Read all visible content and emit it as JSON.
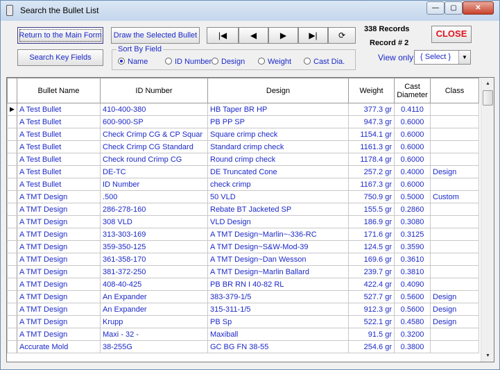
{
  "window": {
    "title": "Search the Bullet List",
    "min": "—",
    "max": "▢",
    "close": "✕"
  },
  "toolbar": {
    "return_label": "Return to the Main Form",
    "draw_label": "Draw the Selected Bullet",
    "search_label": "Search Key Fields",
    "first": "|◀",
    "prev": "◀",
    "next": "▶",
    "last": "▶|",
    "refresh": "⟳",
    "close_label": "CLOSE"
  },
  "status": {
    "records": "338  Records",
    "record": "Record #  2"
  },
  "sortby": {
    "legend": "Sort By Field",
    "options": [
      "Name",
      "ID Number",
      "Design",
      "Weight",
      "Cast Dia."
    ],
    "selected": "Name"
  },
  "view": {
    "label": "View only",
    "value": "{ Select }"
  },
  "grid": {
    "headers": [
      "Bullet Name",
      "ID Number",
      "Design",
      "Weight",
      "Cast\nDiameter",
      "Class"
    ],
    "rows": [
      [
        "A Test Bullet",
        "410-400-380",
        "HB Taper BR HP",
        "377.3 gr",
        "0.4110",
        ""
      ],
      [
        "A Test Bullet",
        "600-900-SP",
        "PB PP SP",
        "947.3 gr",
        "0.6000",
        ""
      ],
      [
        "A Test Bullet",
        "Check Crimp CG & CP Squar",
        "Square crimp check",
        "1154.1 gr",
        "0.6000",
        ""
      ],
      [
        "A Test Bullet",
        "Check Crimp CG Standard",
        "Standard crimp check",
        "1161.3 gr",
        "0.6000",
        ""
      ],
      [
        "A Test Bullet",
        "Check round Crimp CG",
        "Round crimp check",
        "1178.4 gr",
        "0.6000",
        ""
      ],
      [
        "A Test Bullet",
        "DE-TC",
        "DE Truncated Cone",
        "257.2 gr",
        "0.4000",
        "Design"
      ],
      [
        "A Test Bullet",
        "ID Number",
        "check crimp",
        "1167.3 gr",
        "0.6000",
        ""
      ],
      [
        "A TMT Design",
        ".500",
        "50 VLD",
        "750.9 gr",
        "0.5000",
        "Custom"
      ],
      [
        "A TMT Design",
        "286-278-160",
        "Rebate BT Jacketed SP",
        "155.5 gr",
        "0.2860",
        ""
      ],
      [
        "A TMT Design",
        "308 VLD",
        "VLD Design",
        "186.9 gr",
        "0.3080",
        ""
      ],
      [
        "A TMT Design",
        "313-303-169",
        "A TMT Design~Marlin~-336-RC",
        "171.6 gr",
        "0.3125",
        ""
      ],
      [
        "A TMT Design",
        "359-350-125",
        "A TMT Design~S&W-Mod-39",
        "124.5 gr",
        "0.3590",
        ""
      ],
      [
        "A TMT Design",
        "361-358-170",
        "A TMT Design~Dan Wesson",
        "169.6 gr",
        "0.3610",
        ""
      ],
      [
        "A TMT Design",
        "381-372-250",
        "A TMT Design~Marlin Ballard",
        "239.7 gr",
        "0.3810",
        ""
      ],
      [
        "A TMT Design",
        "408-40-425",
        "PB BR RN I 40-82 RL",
        "422.4 gr",
        "0.4090",
        ""
      ],
      [
        "A TMT Design",
        "An Expander",
        "383-379-1/5",
        "527.7 gr",
        "0.5600",
        "Design"
      ],
      [
        "A TMT Design",
        "An Expander",
        "315-311-1/5",
        "912.3 gr",
        "0.5600",
        "Design"
      ],
      [
        "A TMT Design",
        "Krupp",
        "PB Sp",
        "522.1 gr",
        "0.4580",
        "Design"
      ],
      [
        "A TMT Design",
        "Maxi - 32 -",
        "Maxiball",
        "91.5 gr",
        "0.3200",
        ""
      ],
      [
        "Accurate Mold",
        "38-255G",
        "GC BG FN 38-55",
        "254.6 gr",
        "0.3800",
        ""
      ]
    ],
    "current_row_marker": "▶"
  }
}
